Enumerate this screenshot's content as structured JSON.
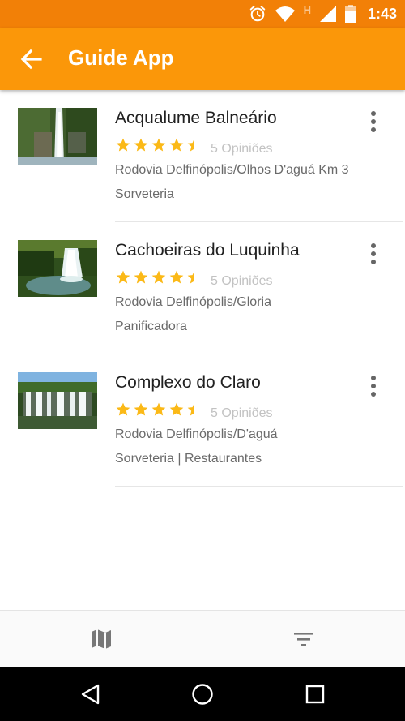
{
  "status_bar": {
    "time": "1:43",
    "network_letter": "H",
    "icons": [
      "alarm-icon",
      "wifi-icon",
      "signal-icon",
      "battery-icon"
    ]
  },
  "app_bar": {
    "title": "Guide App",
    "back_icon": "arrow-back-icon",
    "background_color": "#fb9709",
    "status_color": "#f28007"
  },
  "places": [
    {
      "name": "Acqualume Balneário",
      "rating": 4.5,
      "reviews": "5 Opiniões",
      "address": "Rodovia Delfinópolis/Olhos D'aguá Km 3",
      "categories": "Sorveteria"
    },
    {
      "name": "Cachoeiras do Luquinha",
      "rating": 4.5,
      "reviews": "5 Opiniões",
      "address": "Rodovia Delfinópolis/Gloria",
      "categories": "Panificadora"
    },
    {
      "name": "Complexo do Claro",
      "rating": 4.5,
      "reviews": "5 Opiniões",
      "address": "Rodovia Delfinópolis/D'aguá",
      "categories": "Sorveteria | Restaurantes"
    }
  ],
  "star_color": "#fbb917",
  "bottom_bar": {
    "left_icon": "map-icon",
    "right_icon": "filter-icon"
  },
  "nav_bar": {
    "icons": [
      "nav-back-icon",
      "nav-home-icon",
      "nav-recents-icon"
    ]
  }
}
